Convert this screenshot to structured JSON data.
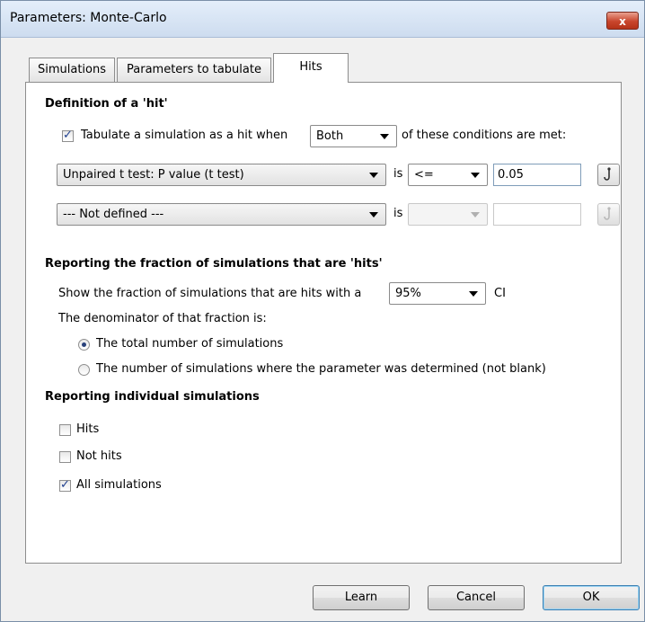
{
  "window": {
    "title": "Parameters: Monte-Carlo",
    "close_glyph": "x"
  },
  "tabs": [
    {
      "label": "Simulations"
    },
    {
      "label": "Parameters to tabulate"
    },
    {
      "label": "Hits"
    }
  ],
  "hits": {
    "definition_heading": "Definition of a 'hit'",
    "tabulate_label": "Tabulate a simulation as a hit when",
    "tabulate_checked": true,
    "condition_mode": "Both",
    "conditions_suffix": "of these conditions are met:",
    "conditions": [
      {
        "parameter": "Unpaired t test: P value (t test)",
        "is_label": "is",
        "operator": "<=",
        "value": "0.05",
        "enabled": true
      },
      {
        "parameter": "--- Not defined ---",
        "is_label": "is",
        "operator": "",
        "value": "",
        "enabled": false
      }
    ],
    "fraction_heading": "Reporting the fraction of simulations that are 'hits'",
    "fraction_prefix": "Show the fraction of simulations that are hits with a",
    "confidence": "95%",
    "ci_label": "CI",
    "denominator_label": "The denominator of that fraction is:",
    "denominator_options": [
      {
        "label": "The total number of simulations",
        "selected": true
      },
      {
        "label": "The number of simulations where the parameter was determined (not blank)",
        "selected": false
      }
    ],
    "individual_heading": "Reporting individual simulations",
    "individual_options": [
      {
        "label": "Hits",
        "checked": false
      },
      {
        "label": "Not hits",
        "checked": false
      },
      {
        "label": "All simulations",
        "checked": true
      }
    ]
  },
  "buttons": {
    "learn": "Learn",
    "cancel": "Cancel",
    "ok": "OK"
  },
  "icons": {
    "hook": "hook-icon",
    "close": "close-icon",
    "dropdown": "chevron-down-icon"
  }
}
